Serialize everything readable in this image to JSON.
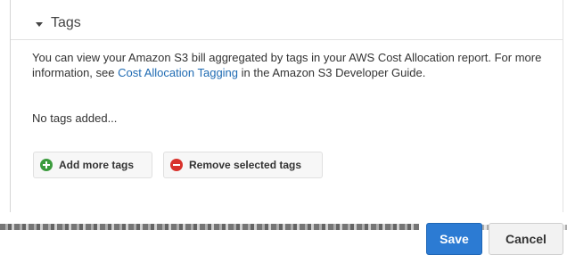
{
  "section": {
    "title": "Tags"
  },
  "description": {
    "text_before_link": "You can view your Amazon S3 bill aggregated by tags in your AWS Cost Allocation report. For more information, see ",
    "link_text": "Cost Allocation Tagging",
    "text_after_link": " in the Amazon S3 Developer Guide."
  },
  "tags": {
    "empty_message": "No tags added..."
  },
  "actions": {
    "add_label": "Add more tags",
    "remove_label": "Remove selected tags"
  },
  "footer": {
    "save_label": "Save",
    "cancel_label": "Cancel"
  },
  "colors": {
    "link": "#1f6bb3",
    "save_button": "#2c7bd3",
    "add_icon": "#3b9b3d",
    "remove_icon": "#d8322c"
  },
  "icons": {
    "caret": "caret-down-icon",
    "add": "add-circle-icon",
    "remove": "remove-circle-icon"
  }
}
